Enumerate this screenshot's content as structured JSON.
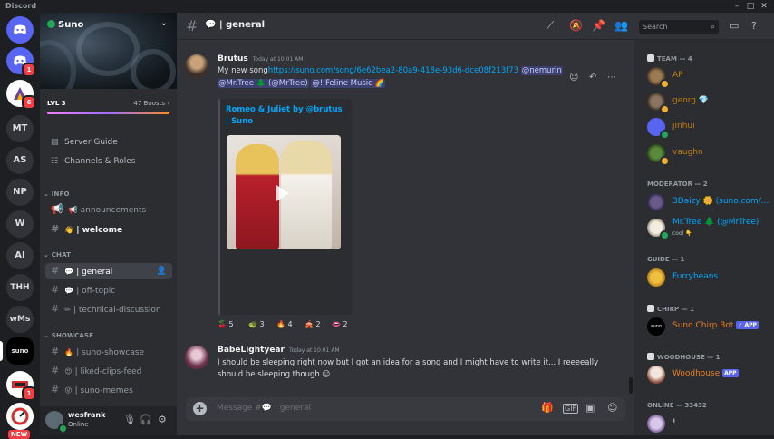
{
  "window": {
    "app_name": "Discord",
    "minimize": "–",
    "maximize": "□",
    "close": "✕"
  },
  "rail": {
    "servers": [
      {
        "label": "MT"
      },
      {
        "label": "AS"
      },
      {
        "label": "NP"
      },
      {
        "label": "W"
      },
      {
        "label": "AI"
      },
      {
        "label": "THH"
      },
      {
        "label": "wMs"
      },
      {
        "label": "suno"
      }
    ],
    "dm_badge": "1",
    "server2_badge": "6",
    "server_last_badge": "1",
    "new_badge": "NEW"
  },
  "sidebar": {
    "server_name": "Suno",
    "boost_level": "LVL 3",
    "boost_count": "47 Boosts",
    "nav": [
      {
        "label": "Server Guide",
        "icon": "server-guide-icon"
      },
      {
        "label": "Channels & Roles",
        "icon": "channels-roles-icon"
      }
    ],
    "categories": {
      "info": "INFO",
      "chat": "CHAT",
      "showcase": "SHOWCASE"
    },
    "channels": {
      "announcements": {
        "emoji": "📢",
        "name": "announcements"
      },
      "welcome": {
        "emoji": "👋",
        "name": "| welcome"
      },
      "general": {
        "emoji": "💬",
        "name": "| general"
      },
      "off_topic": {
        "emoji": "💬",
        "name": "| off-topic"
      },
      "technical": {
        "emoji": "✏",
        "name": "| technical-discussion"
      },
      "suno_showcase": {
        "emoji": "🔥",
        "name": "| suno-showcase"
      },
      "liked_clips": {
        "emoji": "😍",
        "name": "| liked-clips-feed"
      },
      "suno_memes": {
        "emoji": "😜",
        "name": "| suno-memes"
      }
    },
    "user": {
      "name": "wesfrank",
      "status": "Online"
    }
  },
  "chat": {
    "channel_name": "| general",
    "messages": [
      {
        "author": "Brutus",
        "timestamp": "Today at 10:01 AM",
        "line1_text": "My new song",
        "line1_link": "https://suno.com/song/6e62bea2-80a9-418e-93d6-dce08f213f73",
        "mention1": "@nemurin",
        "mention2": "@Mr.Tree 🌲 (@MrTree)",
        "mention3": "@!          Feline Music 🌈",
        "embed_title": "Romeo & Juliet by @brutus | Suno",
        "reactions": [
          {
            "emoji": "🍒",
            "count": "5"
          },
          {
            "emoji": "🐢",
            "count": "3"
          },
          {
            "emoji": "🔥",
            "count": "4"
          },
          {
            "emoji": "🎪",
            "count": "2"
          },
          {
            "emoji": "👄",
            "count": "2"
          }
        ]
      },
      {
        "author": "BabeLightyear",
        "timestamp": "Today at 10:01 AM",
        "line1": "I should be sleeping right now but I got an idea for a song and I might have to write it... I reeeeally",
        "line2": "should be sleeping though 😑"
      }
    ],
    "composer_placeholder": "Message #💬 | general"
  },
  "topbar": {
    "search_placeholder": "Search"
  },
  "members": {
    "roles": [
      {
        "name": "TEAM — 4"
      },
      {
        "name": "MODERATOR — 2"
      },
      {
        "name": "GUIDE — 1"
      },
      {
        "name": "CHIRP — 1"
      },
      {
        "name": "WOODHOUSE — 1"
      },
      {
        "name": "ONLINE — 33432"
      }
    ],
    "team": [
      {
        "name": "AP",
        "color": "#c27c0e"
      },
      {
        "name": "georg 💎",
        "color": "#c27c0e"
      },
      {
        "name": "jinhui",
        "color": "#c27c0e"
      },
      {
        "name": "vaughn",
        "color": "#c27c0e"
      }
    ],
    "moderators": [
      {
        "name": "3Daizy 🌼 (suno.com/...",
        "color": "#00a8fc"
      },
      {
        "name": "Mr.Tree 🌲 (@MrTree)",
        "color": "#00a8fc",
        "sub": "cool 👇"
      }
    ],
    "guide": [
      {
        "name": "Furrybeans",
        "color": "#00a8fc"
      }
    ],
    "chirp": [
      {
        "name": "Suno Chirp Bot",
        "color": "#e67e22",
        "badge": "✓ APP"
      }
    ],
    "woodhouse": [
      {
        "name": "Woodhouse",
        "color": "#e67e22",
        "badge": "APP"
      }
    ],
    "online": [
      {
        "name": "!",
        "color": "#dbdee1"
      }
    ]
  },
  "colors": {
    "accent": "#5865f2",
    "link": "#00a8fc",
    "online": "#23a55a",
    "danger": "#f23f43"
  }
}
